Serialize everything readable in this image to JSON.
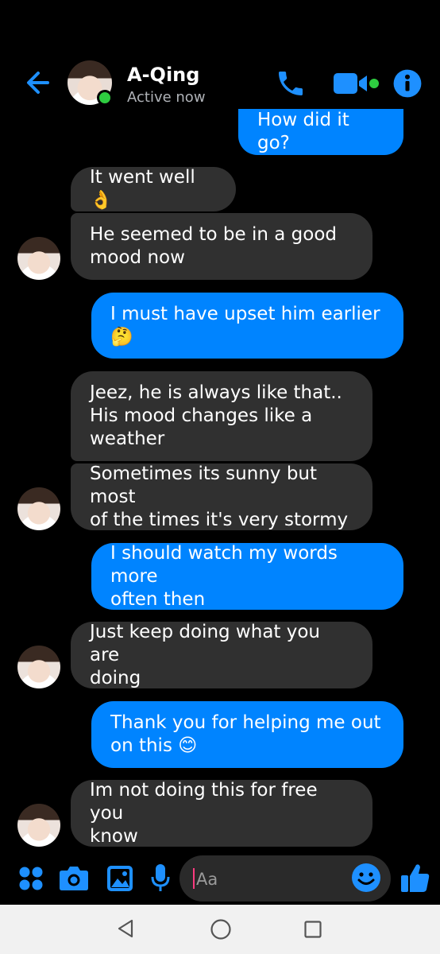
{
  "contact": {
    "name": "A-Qing",
    "status": "Active now"
  },
  "messages": [
    {
      "dir": "out",
      "text": "How did it go?"
    },
    {
      "dir": "in",
      "text": "It went well 👌"
    },
    {
      "dir": "in",
      "text": "He seemed to be in a good\nmood now"
    },
    {
      "dir": "out",
      "text": "I must have upset him earlier\n🤔"
    },
    {
      "dir": "in",
      "text": "Jeez, he is always like that..\nHis mood changes like a\nweather"
    },
    {
      "dir": "in",
      "text": "Sometimes its sunny but most\nof the times it's very stormy"
    },
    {
      "dir": "out",
      "text": "I should watch my words more\noften then"
    },
    {
      "dir": "in",
      "text": "Just keep doing what you are\ndoing"
    },
    {
      "dir": "out",
      "text": "Thank you for helping me out\non this 😊"
    },
    {
      "dir": "in",
      "text": "Im not doing this for free you\nknow"
    }
  ],
  "composer": {
    "placeholder": "Aa"
  },
  "icons": {
    "back": "back-arrow-icon",
    "call": "phone-icon",
    "video": "video-camera-icon",
    "info": "info-icon",
    "menu": "four-dots-icon",
    "camera": "camera-icon",
    "gallery": "image-icon",
    "mic": "microphone-icon",
    "emoji": "emoji-icon",
    "like": "thumbs-up-icon"
  },
  "colors": {
    "accent": "#0084ff",
    "incoming_bubble": "#303030",
    "online": "#2ecc40"
  }
}
